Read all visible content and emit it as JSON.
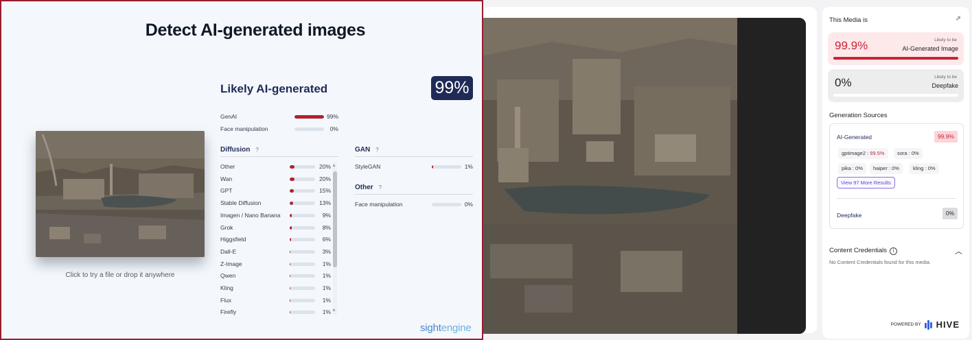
{
  "sightengine": {
    "title": "Detect AI-generated images",
    "upload_hint": "Click to try a file or drop it anywhere",
    "result_title": "Likely AI-generated",
    "score": "99%",
    "top_rows": [
      {
        "label": "GenAI",
        "value": 99,
        "pct": "99%"
      },
      {
        "label": "Face manipulation",
        "value": 0,
        "pct": "0%"
      }
    ],
    "diffusion": {
      "heading": "Diffusion",
      "rows": [
        {
          "label": "Other",
          "value": 20,
          "pct": "20%"
        },
        {
          "label": "Wan",
          "value": 20,
          "pct": "20%"
        },
        {
          "label": "GPT",
          "value": 15,
          "pct": "15%"
        },
        {
          "label": "Stable Diffusion",
          "value": 13,
          "pct": "13%"
        },
        {
          "label": "Imagen / Nano Banana",
          "value": 9,
          "pct": "9%"
        },
        {
          "label": "Grok",
          "value": 8,
          "pct": "8%"
        },
        {
          "label": "Higgsfield",
          "value": 6,
          "pct": "6%"
        },
        {
          "label": "Dall-E",
          "value": 3,
          "pct": "3%"
        },
        {
          "label": "Z-Image",
          "value": 1,
          "pct": "1%"
        },
        {
          "label": "Qwen",
          "value": 1,
          "pct": "1%"
        },
        {
          "label": "Kling",
          "value": 1,
          "pct": "1%"
        },
        {
          "label": "Flux",
          "value": 1,
          "pct": "1%"
        },
        {
          "label": "Firefly",
          "value": 1,
          "pct": "1%"
        }
      ]
    },
    "gan": {
      "heading": "GAN",
      "rows": [
        {
          "label": "StyleGAN",
          "value": 1,
          "pct": "1%"
        }
      ]
    },
    "other": {
      "heading": "Other",
      "rows": [
        {
          "label": "Face manipulation",
          "value": 0,
          "pct": "0%"
        }
      ]
    },
    "help_glyph": "?",
    "brand_a": "sight",
    "brand_b": "engine",
    "colors": {
      "accent": "#b3202f",
      "navy": "#1f2a55"
    }
  },
  "hive": {
    "media_title": "This Media is",
    "ai_card": {
      "score": "99.9%",
      "value": 99.9,
      "likely": "Likely to be",
      "kind": "AI-Generated Image"
    },
    "df_card": {
      "score": "0%",
      "value": 0,
      "likely": "Likely to be",
      "kind": "Deepfake"
    },
    "gen_title": "Generation Sources",
    "gen_ai_label": "AI-Generated",
    "gen_ai_value": "99.9%",
    "chips": [
      {
        "name": "gptimage2",
        "value": "99.5%"
      },
      {
        "name": "sora",
        "value": "0%"
      },
      {
        "name": "pika",
        "value": "0%"
      },
      {
        "name": "haiper",
        "value": "0%"
      },
      {
        "name": "kling",
        "value": "0%"
      }
    ],
    "more_button": "View 97 More Results",
    "deepfake_label": "Deepfake",
    "deepfake_value": "0%",
    "cc_title": "Content Credentials",
    "cc_text": "No Content Credentials found for this media.",
    "powered_by": "POWERED BY",
    "brand": "HIVE",
    "colors": {
      "accent": "#c82434",
      "button": "#5a48c8"
    }
  }
}
